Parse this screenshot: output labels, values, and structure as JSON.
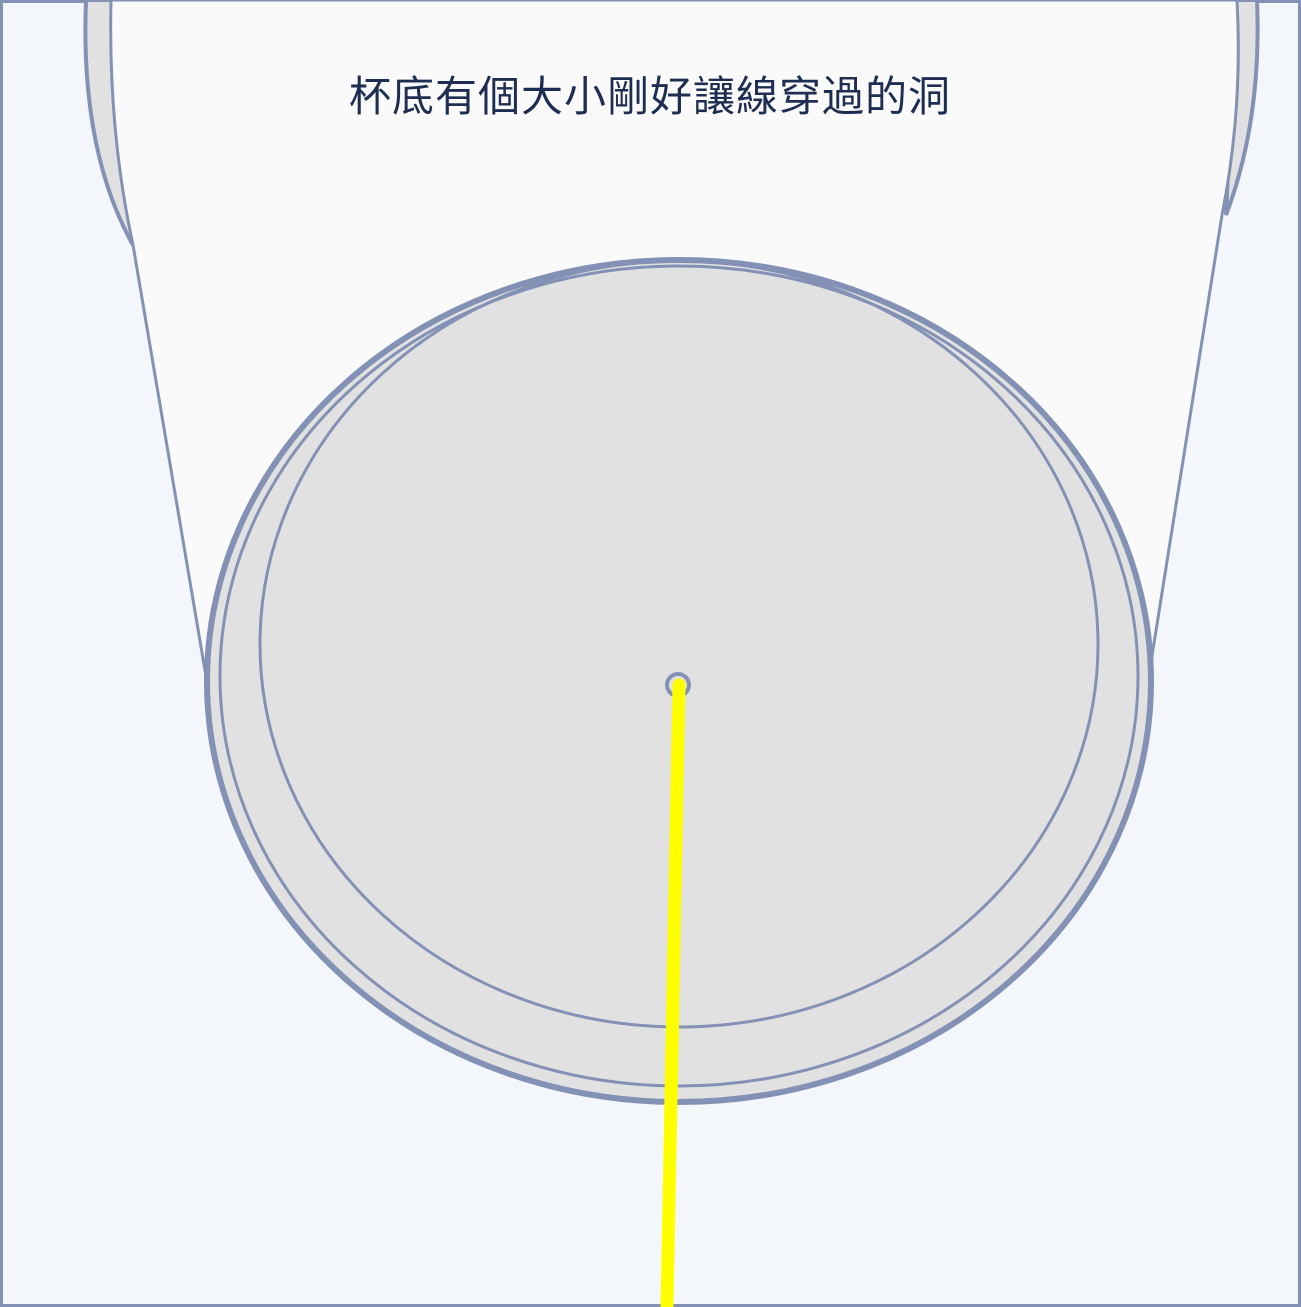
{
  "caption": "杯底有個大小剛好讓線穿過的洞",
  "colors": {
    "background": "#f3f7fb",
    "outline": "#8391b5",
    "cup_fill": "#fafafa",
    "cup_base_fill": "#e1e1e1",
    "thread": "#ffff00",
    "caption_text": "#1e2d52"
  },
  "icons": {
    "cup": "cup-bottom-icon",
    "hole": "hole-icon",
    "thread": "thread-line"
  }
}
